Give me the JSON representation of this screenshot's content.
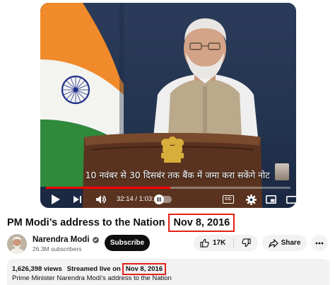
{
  "player": {
    "subtitle_text": "10 नवंबर से 30 दिसबंर तक बैंक में जमा करा सकेंगे नोट",
    "time_current": "32:14",
    "time_total": "1:03:0",
    "progress_fraction": 0.51,
    "cc_label": "CC",
    "controls": [
      "play-icon",
      "next-icon",
      "volume-icon",
      "autoplay-toggle",
      "subtitles-icon",
      "settings-gear-icon",
      "miniplayer-icon",
      "theater-mode-icon",
      "fullscreen-icon"
    ]
  },
  "video": {
    "title": "PM Modi’s address to the Nation",
    "title_date": "Nov 8, 2016"
  },
  "channel": {
    "name": "Narendra Modi",
    "subscribers": "26.3M subscribers",
    "subscribe_label": "Subscribe"
  },
  "actions": {
    "like_count": "17K",
    "share_label": "Share"
  },
  "description": {
    "views": "1,626,398 views",
    "streamed_prefix": "Streamed live on",
    "date": "Nov 8, 2016",
    "text": "Prime Minister Narendra Modi’s address to the Nation"
  },
  "colors": {
    "highlight_border": "#e32119",
    "progress": "#ff0000",
    "subscribe_bg": "#0f0f0f"
  }
}
